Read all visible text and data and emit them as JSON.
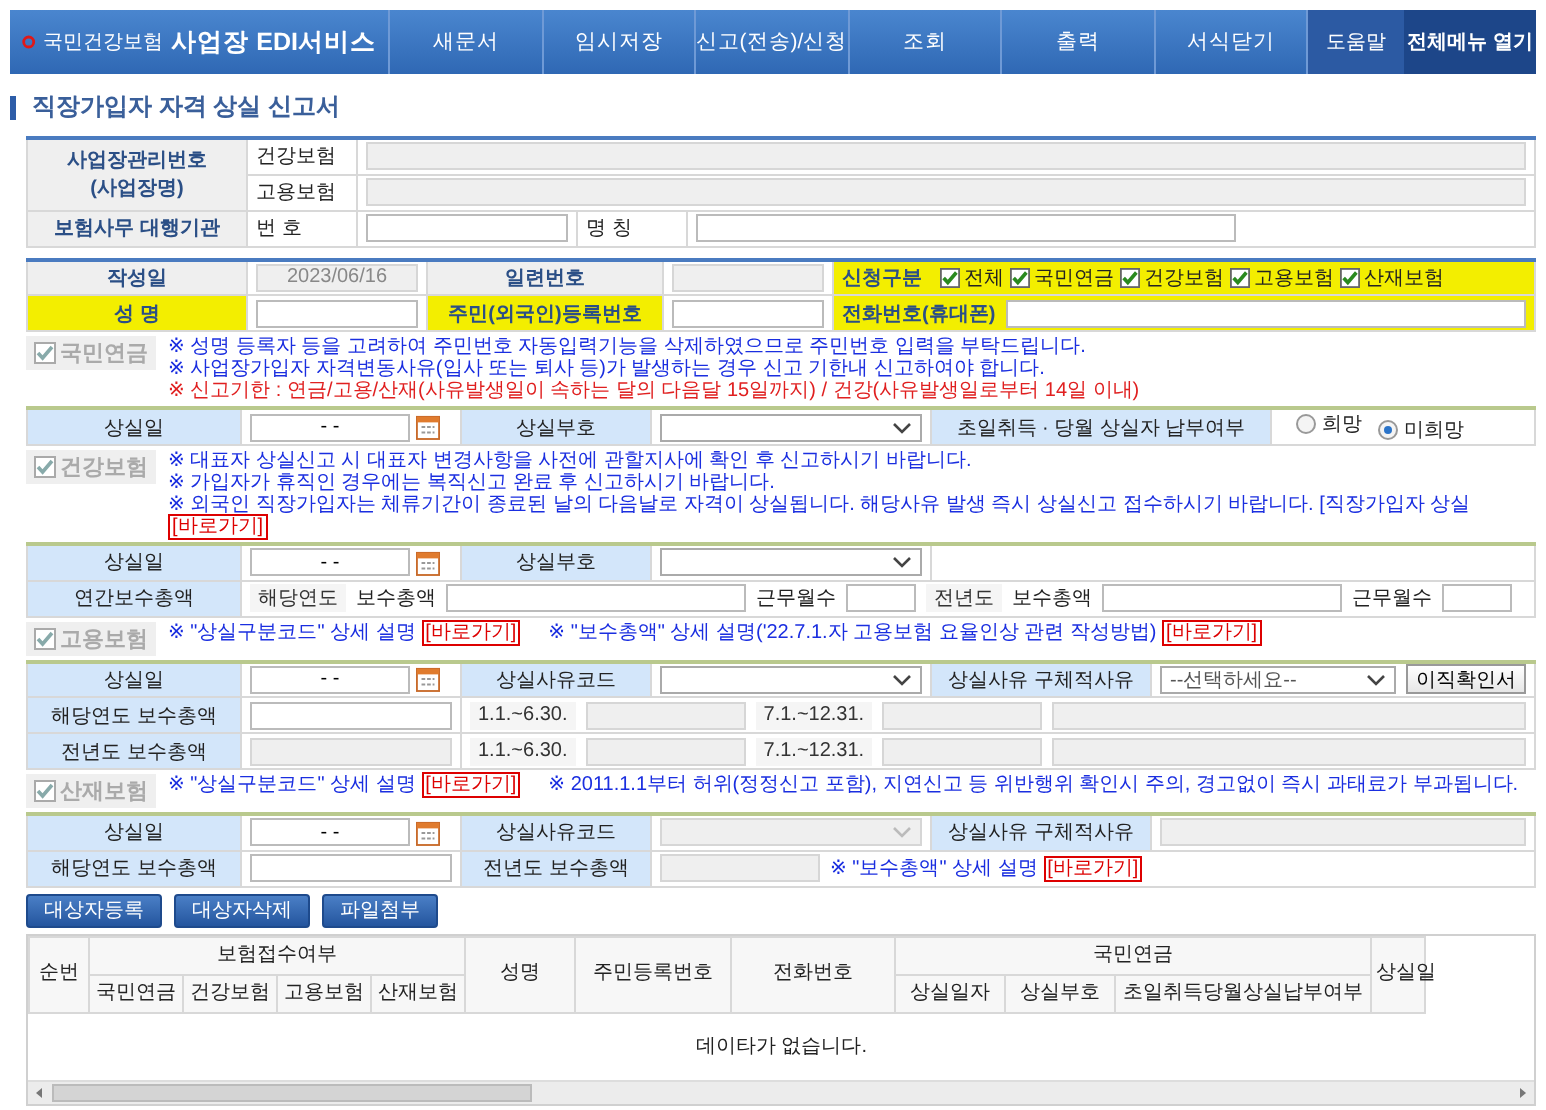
{
  "header": {
    "logo_text": "국민건강보험",
    "service": "사업장 EDI서비스",
    "menu": [
      "새문서",
      "임시저장",
      "신고(전송)/신청",
      "조회",
      "출력",
      "서식닫기"
    ],
    "help": "도움말",
    "all_menu": "전체메뉴 열기"
  },
  "page_title": "직장가입자 자격 상실 신고서",
  "workplace": {
    "label_lines": [
      "사업장관리번호",
      "(사업장명)"
    ],
    "rows": [
      "건강보험",
      "고용보험"
    ]
  },
  "agency": {
    "label": "보험사무 대행기관",
    "number_label": "번 호",
    "name_label": "명 칭"
  },
  "basic": {
    "date": {
      "label": "작성일",
      "value": "2023/06/16"
    },
    "serial": {
      "label": "일련번호"
    },
    "apply": {
      "label": "신청구분",
      "highlighted": true,
      "options": [
        {
          "label": "전체",
          "checked": true
        },
        {
          "label": "국민연금",
          "checked": true
        },
        {
          "label": "건강보험",
          "checked": true
        },
        {
          "label": "고용보험",
          "checked": true
        },
        {
          "label": "산재보험",
          "checked": true
        }
      ]
    },
    "name": {
      "label": "성 명",
      "highlighted": true
    },
    "rrn": {
      "label": "주민(외국인)등록번호",
      "highlighted": true
    },
    "phone": {
      "label": "전화번호(휴대폰)",
      "highlighted": true
    }
  },
  "pension": {
    "label": "국민연금",
    "checked": true,
    "disabled": true,
    "notices": [
      {
        "kind": "info",
        "text": "※ 성명 등록자 등을 고려하여 주민번호 자동입력기능을 삭제하였으므로 주민번호 입력을 부탁드립니다."
      },
      {
        "kind": "info",
        "text": "※ 사업장가입자 자격변동사유(입사 또는 퇴사 등)가 발생하는 경우 신고 기한내 신고하여야 합니다."
      },
      {
        "kind": "warning",
        "text": "※ 신고기한 : 연금/고용/산재(사유발생일이 속하는 달의 다음달 15일까지) / 건강(사유발생일로부터 14일 이내)"
      }
    ],
    "loss_date_label": "상실일",
    "loss_date_value": "- -",
    "loss_code_label": "상실부호",
    "payment_label": "초일취득 · 당월 상실자 납부여부",
    "payment_options": [
      {
        "label": "희망",
        "selected": false
      },
      {
        "label": "미희망",
        "selected": true
      }
    ]
  },
  "health": {
    "label": "건강보험",
    "checked": true,
    "disabled": true,
    "notices": [
      {
        "kind": "info",
        "text": "※ 대표자 상실신고 시 대표자 변경사항을 사전에 관할지사에 확인 후 신고하시기 바랍니다."
      },
      {
        "kind": "info",
        "text": "※ 가입자가 휴직인 경우에는 복직신고 완료 후 신고하시기 바랍니다."
      },
      {
        "kind": "info",
        "text": "※ 외국인 직장가입자는 체류기간이 종료된 날의 다음날로 자격이 상실됩니다. 해당사유 발생 즉시 상실신고 접수하시기 바랍니다. [직장가입자 상실",
        "link": "[바로가기]"
      }
    ],
    "loss_date_label": "상실일",
    "loss_date_value": "- -",
    "loss_code_label": "상실부호",
    "annual_label": "연간보수총액",
    "current_year_label": "해당연도",
    "current_pay_label": "보수총액",
    "current_months_label": "근무월수",
    "prev_year_label": "전년도",
    "prev_pay_label": "보수총액",
    "prev_months_label": "근무월수"
  },
  "employment": {
    "label": "고용보험",
    "checked": true,
    "disabled": true,
    "notices": [
      {
        "kind": "info",
        "text": "※ \"상실구분코드\" 상세 설명",
        "link": "[바로가기]"
      },
      {
        "kind": "info",
        "text": "※ \"보수총액\" 상세 설명('22.7.1.자 고용보험 요율인상 관련 작성방법)",
        "link": "[바로가기]"
      }
    ],
    "loss_date_label": "상실일",
    "loss_date_value": "- -",
    "reason_code_label": "상실사유코드",
    "reason_detail_label": "상실사유 구체적사유",
    "reason_detail_placeholder": "--선택하세요--",
    "certificate_button": "이직확인서",
    "current_pay_label": "해당연도 보수총액",
    "current_periods": [
      "1.1.~6.30.",
      "7.1.~12.31."
    ],
    "prev_pay_label": "전년도 보수총액",
    "prev_periods": [
      "1.1.~6.30.",
      "7.1.~12.31."
    ]
  },
  "industrial": {
    "label": "산재보험",
    "checked": true,
    "disabled": true,
    "notices": [
      {
        "kind": "info",
        "text": "※ \"상실구분코드\" 상세 설명",
        "link": "[바로가기]"
      },
      {
        "kind": "info",
        "text": "※ 2011.1.1부터 허위(정정신고 포함), 지연신고 등 위반행위 확인시 주의, 경고없이 즉시 과태료가 부과됩니다."
      }
    ],
    "loss_date_label": "상실일",
    "loss_date_value": "- -",
    "reason_code_label": "상실사유코드",
    "reason_detail_label": "상실사유 구체적사유",
    "current_pay_label": "해당연도 보수총액",
    "prev_pay_label": "전년도 보수총액",
    "pay_note": {
      "kind": "info",
      "text": "※ \"보수총액\" 상세 설명",
      "link": "[바로가기]"
    }
  },
  "actions": [
    "대상자등록",
    "대상자삭제",
    "파일첨부"
  ],
  "grid": {
    "columns": [
      {
        "label": "순번"
      },
      {
        "label": "보험접수여부",
        "children": [
          "국민연금",
          "건강보험",
          "고용보험",
          "산재보험"
        ]
      },
      {
        "label": "성명"
      },
      {
        "label": "주민등록번호"
      },
      {
        "label": "전화번호"
      },
      {
        "label": "국민연금",
        "children": [
          "상실일자",
          "상실부호",
          "초일취득당월상실납부여부"
        ]
      },
      {
        "label": "상실일"
      }
    ],
    "empty_message": "데이타가 없습니다."
  }
}
